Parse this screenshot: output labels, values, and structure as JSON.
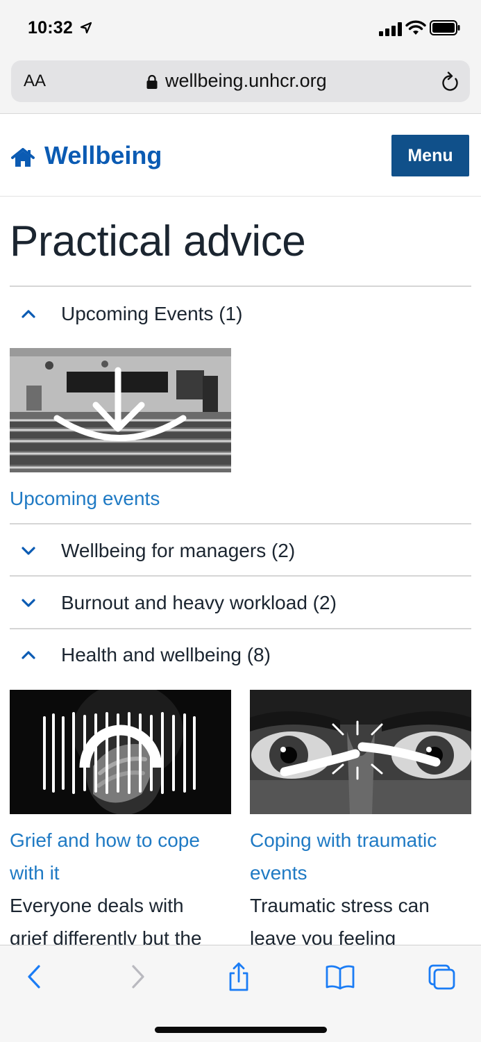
{
  "status_bar": {
    "time": "10:32"
  },
  "browser": {
    "text_size_label": "AA",
    "url": "wellbeing.unhcr.org"
  },
  "header": {
    "site_title": "Wellbeing",
    "menu_label": "Menu"
  },
  "page": {
    "title": "Practical advice"
  },
  "sections": [
    {
      "label": "Upcoming Events (1)",
      "expanded": true
    },
    {
      "label": "Wellbeing for managers (2)",
      "expanded": false
    },
    {
      "label": "Burnout and heavy workload (2)",
      "expanded": false
    },
    {
      "label": "Health and wellbeing (8)",
      "expanded": true
    }
  ],
  "cards": {
    "upcoming": {
      "title": "Upcoming events"
    },
    "grief": {
      "title_line1": "Grief and how to cope",
      "title_line2": "with it",
      "desc_line1": "Everyone deals with",
      "desc_line2": "grief differently but the"
    },
    "trauma": {
      "title_line1": "Coping with traumatic",
      "title_line2": "events",
      "desc_line1": "Traumatic stress can",
      "desc_line2": "leave you feeling"
    }
  },
  "colors": {
    "brand_blue": "#0b5bb3",
    "menu_button": "#10508a",
    "link_blue": "#1f7ac4",
    "safari_blue": "#1a7cf5"
  }
}
